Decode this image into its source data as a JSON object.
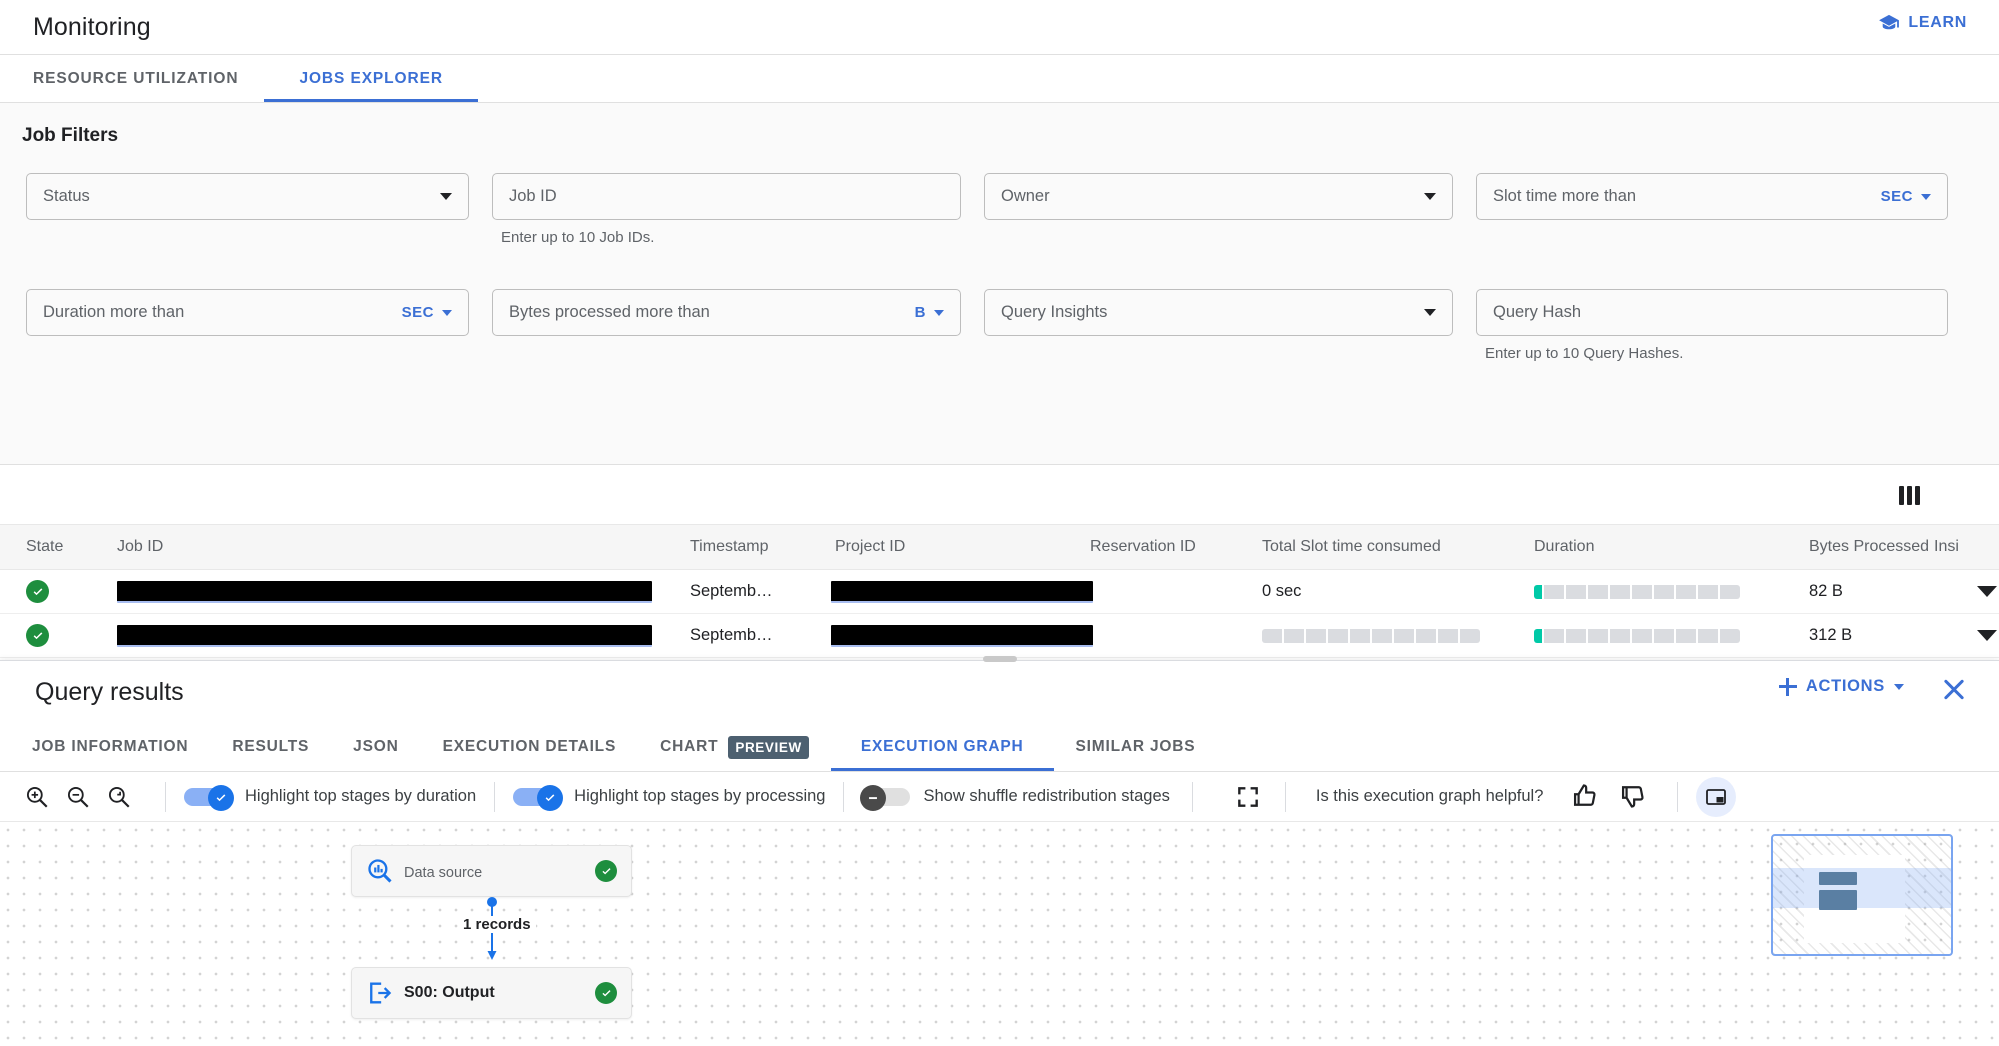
{
  "header": {
    "title": "Monitoring",
    "learn_label": "LEARN",
    "learn_icon": "graduation-cap-icon"
  },
  "tabs": [
    {
      "label": "RESOURCE UTILIZATION",
      "active": false
    },
    {
      "label": "JOBS EXPLORER",
      "active": true
    }
  ],
  "filters": {
    "title": "Job Filters",
    "fields": [
      {
        "label": "Status",
        "type": "select",
        "hint": ""
      },
      {
        "label": "Job ID",
        "type": "text",
        "hint": "Enter up to 10 Job IDs."
      },
      {
        "label": "Owner",
        "type": "select",
        "hint": ""
      },
      {
        "label": "Slot time more than",
        "type": "unit",
        "unit": "SEC",
        "hint": ""
      },
      {
        "label": "Duration more than",
        "type": "unit",
        "unit": "SEC",
        "hint": ""
      },
      {
        "label": "Bytes processed more than",
        "type": "unit",
        "unit": "B",
        "hint": ""
      },
      {
        "label": "Query Insights",
        "type": "select",
        "hint": ""
      },
      {
        "label": "Query Hash",
        "type": "text",
        "hint": "Enter up to 10 Query Hashes."
      }
    ]
  },
  "table": {
    "columns_icon": "columns-settings-icon",
    "headers": {
      "state": "State",
      "job_id": "Job ID",
      "timestamp": "Timestamp",
      "project_id": "Project ID",
      "reservation_id": "Reservation ID",
      "slot_time": "Total Slot time consumed",
      "duration": "Duration",
      "bytes": "Bytes Processed",
      "insights": "Insi"
    },
    "rows": [
      {
        "state": "succeeded",
        "job_id": "",
        "timestamp": "Septemb…",
        "project_id": "",
        "reservation_id": "",
        "slot_time": "0 sec",
        "slot_bar": false,
        "duration_bar": true,
        "bytes": "82 B"
      },
      {
        "state": "succeeded",
        "job_id": "",
        "timestamp": "Septemb…",
        "project_id": "",
        "reservation_id": "",
        "slot_time": "",
        "slot_bar": true,
        "duration_bar": true,
        "bytes": "312 B"
      }
    ]
  },
  "query_results": {
    "title": "Query results",
    "actions_label": "ACTIONS",
    "close_icon": "close-icon",
    "tabs": [
      {
        "label": "JOB INFORMATION",
        "badge": "",
        "active": false
      },
      {
        "label": "RESULTS",
        "badge": "",
        "active": false
      },
      {
        "label": "JSON",
        "badge": "",
        "active": false
      },
      {
        "label": "EXECUTION DETAILS",
        "badge": "",
        "active": false
      },
      {
        "label": "CHART",
        "badge": "PREVIEW",
        "active": false
      },
      {
        "label": "EXECUTION GRAPH",
        "badge": "",
        "active": true
      },
      {
        "label": "SIMILAR JOBS",
        "badge": "",
        "active": false
      }
    ]
  },
  "graph_toolbar": {
    "zoom_in_icon": "zoom-in-icon",
    "zoom_out_icon": "zoom-out-icon",
    "zoom_reset_icon": "zoom-reset-icon",
    "toggles": [
      {
        "label": "Highlight top stages by duration",
        "on": true
      },
      {
        "label": "Highlight top stages by processing",
        "on": true
      },
      {
        "label": "Show shuffle redistribution stages",
        "on": false
      }
    ],
    "fullscreen_icon": "fullscreen-icon",
    "feedback_question": "Is this execution graph helpful?",
    "thumb_up_icon": "thumb-up-icon",
    "thumb_down_icon": "thumb-down-icon",
    "minimap_toggle_icon": "minimap-panel-icon"
  },
  "graph": {
    "nodes": [
      {
        "name": "",
        "redacted": true,
        "subtitle": "Data source",
        "icon": "data-source-icon",
        "status": "success"
      },
      {
        "name": "S00: Output",
        "redacted": false,
        "subtitle": "",
        "icon": "output-icon",
        "status": "success"
      }
    ],
    "edge_label": "1 records"
  },
  "colors": {
    "accent_blue": "#3b6fd4",
    "link_blue": "#1a73e8",
    "success_green": "#1e8e3e",
    "bar_teal": "#00c9a7",
    "badge_slate": "#4d6070"
  }
}
